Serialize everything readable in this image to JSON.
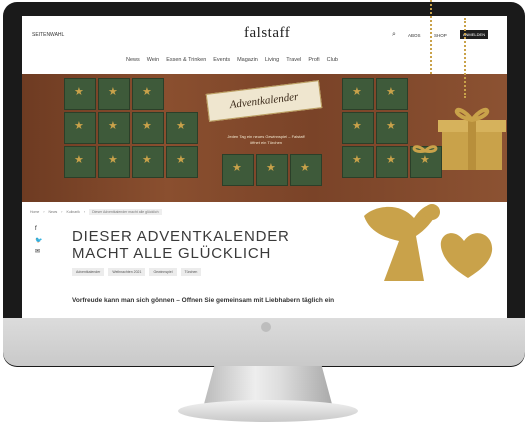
{
  "topbar": {
    "edition": "SEITENWAHL",
    "logo": "falstaff",
    "links": [
      "ABOS",
      "SHOP"
    ],
    "abo_button": "ANMELDEN"
  },
  "nav": {
    "items": [
      "News",
      "Wein",
      "Essen & Trinken",
      "Events",
      "Magazin",
      "Living",
      "Travel",
      "Profi",
      "Club"
    ]
  },
  "hero": {
    "banner": "Adventkalender",
    "subtitle": "Jeden Tag ein neues Gewinnspiel – Falstaff öffnet ein Türchen"
  },
  "breadcrumb": [
    "Home",
    "News",
    "Kulinarik",
    "Dieser Adventkalender macht alle glücklich"
  ],
  "headline": "DIESER ADVENTKALENDER MACHT ALLE GLÜCKLICH",
  "tags": [
    "Adventkalender",
    "Weihnachten 2021",
    "Gewinnspiel",
    "Türchen"
  ],
  "teaser": "Vorfreude kann man sich gönnen – Öffnen Sie gemeinsam mit Liebhabern täglich ein",
  "colors": {
    "gold": "#c9a24a",
    "hero_brown": "#7a4328",
    "calendar_green": "#3e5a3a"
  }
}
